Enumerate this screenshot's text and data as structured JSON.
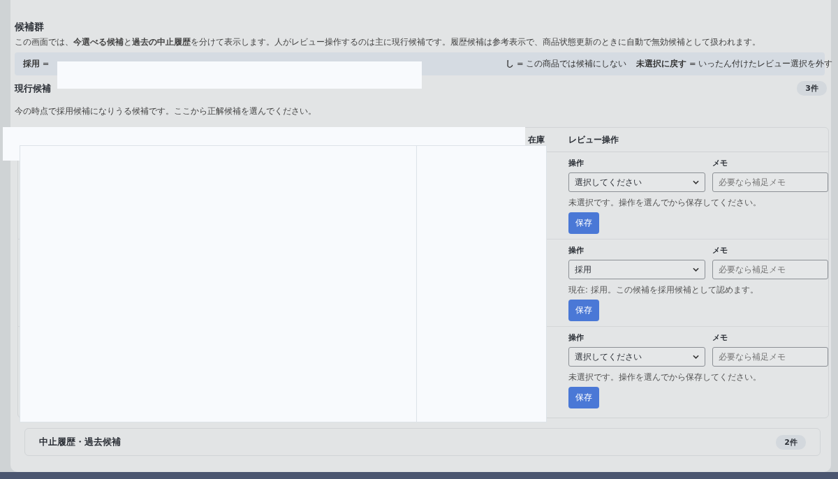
{
  "section": {
    "title": "候補群",
    "description": "この画面では、**今選べる候補**と**過去の中止履歴**を分けて表示します。人がレビュー操作するのは主に現行候補です。履歴候補は参考表示で、商品状態更新のときに自動で無効候補として扱われます。"
  },
  "legend": [
    "**採用** =",
    "**し** = この商品では候補にしない",
    "**未選択に戻す** = いったん付けたレビュー選択を外す"
  ],
  "current": {
    "title": "現行候補",
    "count": "3件",
    "description": "今の時点で採用候補になりうる候補です。ここから正解候補を選んでください。",
    "columns": [
      "在庫",
      "レビュー操作"
    ],
    "rows": [
      {
        "action_label": "操作",
        "action": "選択してください",
        "memo_label": "メモ",
        "memo_placeholder": "必要なら補足メモ",
        "note": "未選択です。操作を選んでから保存してください。",
        "button": "保存"
      },
      {
        "action_label": "操作",
        "action": "採用",
        "memo_label": "メモ",
        "memo_placeholder": "必要なら補足メモ",
        "note": "現在: 採用。この候補を採用候補として認めます。",
        "button": "保存"
      },
      {
        "action_label": "操作",
        "action": "選択してください",
        "memo_label": "メモ",
        "memo_placeholder": "必要なら補足メモ",
        "note": "未選択です。操作を選んでから保存してください。",
        "button": "保存"
      }
    ]
  },
  "history": {
    "title": "中止履歴・過去候補",
    "count": "2件"
  }
}
